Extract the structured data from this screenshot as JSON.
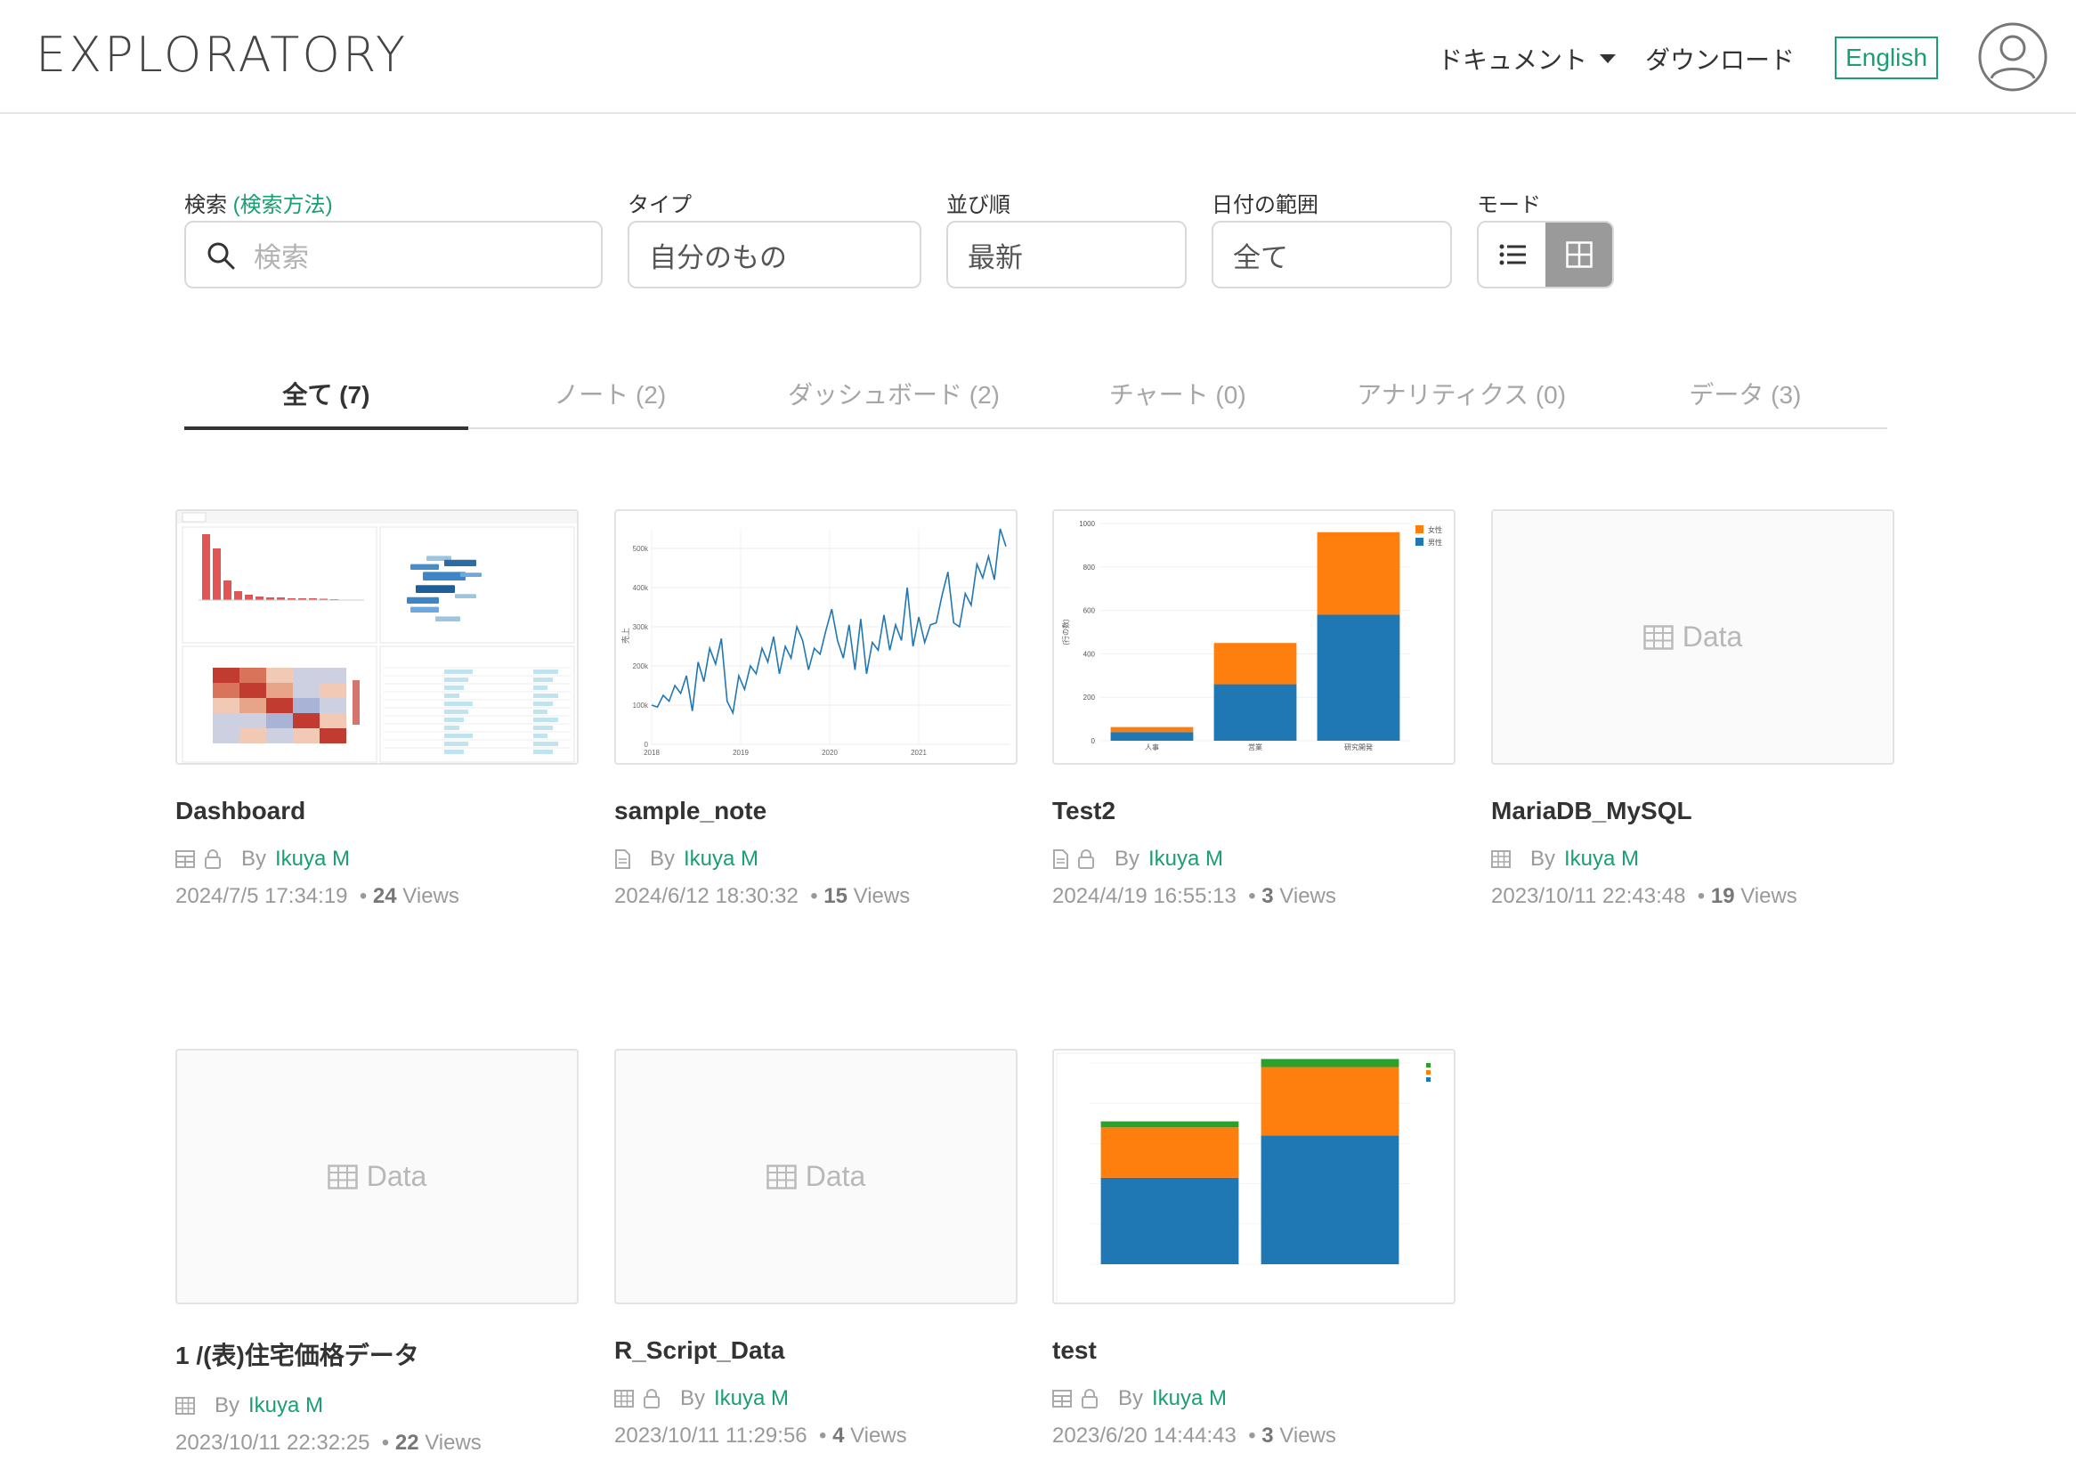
{
  "header": {
    "logo": "EXPLORATORY",
    "docs_label": "ドキュメント",
    "download_label": "ダウンロード",
    "language_button": "English"
  },
  "filters": {
    "search": {
      "label": "検索",
      "help_link": "(検索方法)",
      "placeholder": "検索"
    },
    "type": {
      "label": "タイプ",
      "value": "自分のもの"
    },
    "sort": {
      "label": "並び順",
      "value": "最新"
    },
    "date_range": {
      "label": "日付の範囲",
      "value": "全て"
    },
    "mode": {
      "label": "モード",
      "active": "grid"
    }
  },
  "tabs": [
    {
      "label": "全て (7)",
      "active": true
    },
    {
      "label": "ノート (2)",
      "active": false
    },
    {
      "label": "ダッシュボード (2)",
      "active": false
    },
    {
      "label": "チャート (0)",
      "active": false
    },
    {
      "label": "アナリティクス (0)",
      "active": false
    },
    {
      "label": "データ (3)",
      "active": false
    }
  ],
  "items": [
    {
      "title": "Dashboard",
      "type_icon": "dashboard-icon",
      "locked": true,
      "by": "By",
      "author": "Ikuya M",
      "date": "2024/7/5 17:34:19",
      "views": "24",
      "views_label": "Views",
      "thumbnail": "dashboard"
    },
    {
      "title": "sample_note",
      "type_icon": "note-icon",
      "locked": false,
      "by": "By",
      "author": "Ikuya M",
      "date": "2024/6/12 18:30:32",
      "views": "15",
      "views_label": "Views",
      "thumbnail": "line-chart"
    },
    {
      "title": "Test2",
      "type_icon": "note-icon",
      "locked": true,
      "by": "By",
      "author": "Ikuya M",
      "date": "2024/4/19 16:55:13",
      "views": "3",
      "views_label": "Views",
      "thumbnail": "stacked-bar"
    },
    {
      "title": "MariaDB_MySQL",
      "type_icon": "table-icon",
      "locked": false,
      "by": "By",
      "author": "Ikuya M",
      "date": "2023/10/11 22:43:48",
      "views": "19",
      "views_label": "Views",
      "thumbnail": "data"
    },
    {
      "title": "1 /(表)住宅価格データ",
      "type_icon": "table-icon",
      "locked": false,
      "by": "By",
      "author": "Ikuya M",
      "date": "2023/10/11 22:32:25",
      "views": "22",
      "views_label": "Views",
      "thumbnail": "data"
    },
    {
      "title": "R_Script_Data",
      "type_icon": "table-icon",
      "locked": true,
      "by": "By",
      "author": "Ikuya M",
      "date": "2023/10/11 11:29:56",
      "views": "4",
      "views_label": "Views",
      "thumbnail": "data"
    },
    {
      "title": "test",
      "type_icon": "dashboard-icon",
      "locked": true,
      "by": "By",
      "author": "Ikuya M",
      "date": "2023/6/20 14:44:43",
      "views": "3",
      "views_label": "Views",
      "thumbnail": "stacked-bar-3"
    }
  ],
  "data_placeholder": "Data",
  "colors": {
    "accent": "#1a9f72",
    "blue": "#1f77b4",
    "orange": "#ff7f0e",
    "green": "#2ca02c",
    "red": "#e05555"
  },
  "chart_data": [
    {
      "type": "line",
      "x_ticks": [
        "2018",
        "2019",
        "2020",
        "2021"
      ],
      "ylabel": "売上",
      "y_ticks": [
        "0",
        "100k",
        "200k",
        "300k",
        "400k",
        "500k"
      ],
      "ylim": [
        0,
        550000
      ],
      "values": [
        100000,
        95000,
        125000,
        110000,
        150000,
        130000,
        175000,
        85000,
        210000,
        160000,
        245000,
        205000,
        270000,
        110000,
        80000,
        175000,
        140000,
        200000,
        180000,
        245000,
        210000,
        275000,
        180000,
        250000,
        220000,
        300000,
        265000,
        190000,
        245000,
        230000,
        290000,
        345000,
        265000,
        220000,
        305000,
        190000,
        320000,
        180000,
        260000,
        240000,
        330000,
        240000,
        305000,
        265000,
        400000,
        250000,
        325000,
        260000,
        305000,
        310000,
        380000,
        440000,
        310000,
        300000,
        385000,
        355000,
        460000,
        425000,
        480000,
        420000,
        550000,
        505000
      ]
    },
    {
      "type": "bar",
      "categories": [
        "人事",
        "営業",
        "研究開発"
      ],
      "ylabel": "(行の数)",
      "y_ticks": [
        "0",
        "200",
        "400",
        "600",
        "800",
        "1000"
      ],
      "ylim": [
        0,
        1000
      ],
      "series": [
        {
          "name": "男性",
          "values": [
            40,
            260,
            580
          ]
        },
        {
          "name": "女性",
          "values": [
            23,
            190,
            380
          ]
        }
      ]
    },
    {
      "type": "bar",
      "categories": [
        "",
        ""
      ],
      "ylim": [
        0,
        1000
      ],
      "series": [
        {
          "values": [
            430,
            640
          ]
        },
        {
          "values": [
            250,
            340
          ]
        },
        {
          "values": [
            30,
            40
          ]
        }
      ]
    }
  ]
}
